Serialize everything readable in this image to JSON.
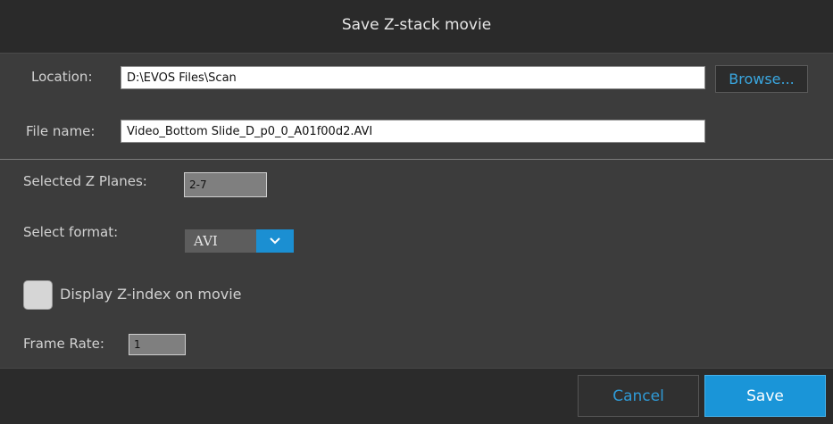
{
  "dialog": {
    "title": "Save Z-stack movie"
  },
  "location": {
    "label": "Location:",
    "value": "D:\\EVOS Files\\Scan",
    "browse_label": "Browse..."
  },
  "file_name": {
    "label": "File name:",
    "value": "Video_Bottom Slide_D_p0_0_A01f00d2.AVI"
  },
  "z_planes": {
    "label": "Selected Z Planes:",
    "value": "2-7"
  },
  "format": {
    "label": "Select format:",
    "selected": "AVI"
  },
  "display_z_index": {
    "label": "Display Z-index on movie",
    "checked": false
  },
  "frame_rate": {
    "label": "Frame Rate:",
    "value": "1"
  },
  "footer": {
    "cancel_label": "Cancel",
    "save_label": "Save"
  },
  "colors": {
    "accent": "#1a95d8",
    "link": "#2f9ad6",
    "background": "#3c3c3c",
    "titlebar": "#2a2a2a"
  },
  "icons": {
    "dropdown": "chevron-down-icon"
  }
}
